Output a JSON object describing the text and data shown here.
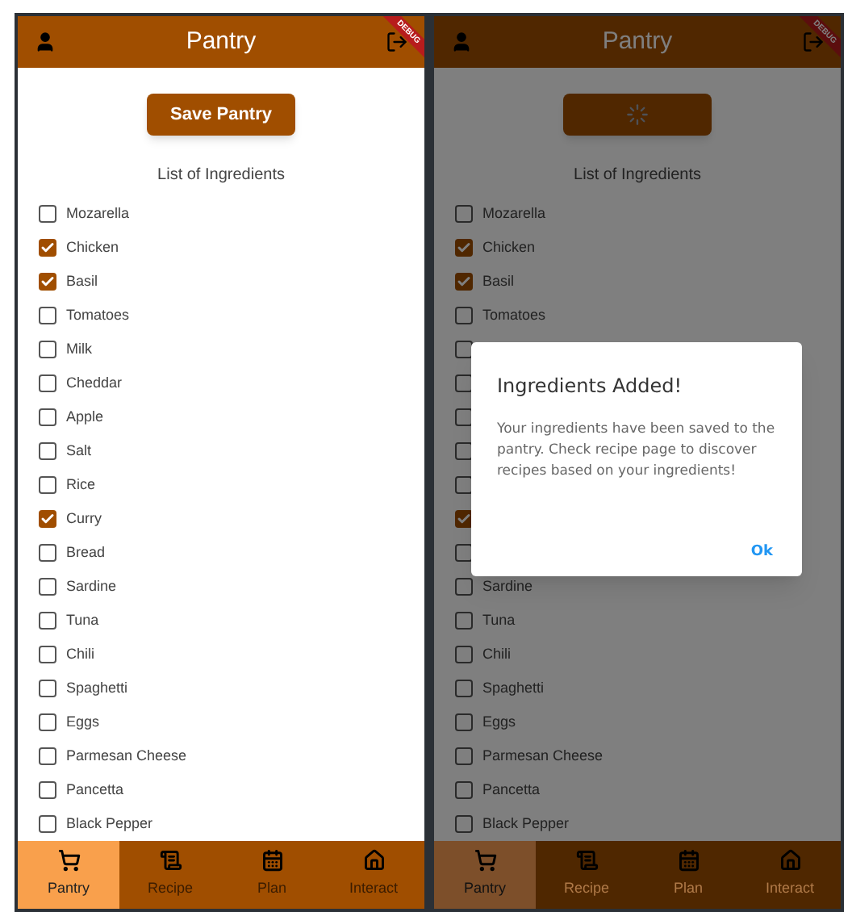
{
  "screens": [
    {
      "title": "Pantry",
      "debug_banner": "DEBUG",
      "save_button": {
        "kind": "label",
        "label": "Save Pantry"
      },
      "list_heading": "List of Ingredients",
      "ingredients": [
        {
          "label": "Mozarella",
          "checked": false
        },
        {
          "label": "Chicken",
          "checked": true
        },
        {
          "label": "Basil",
          "checked": true
        },
        {
          "label": "Tomatoes",
          "checked": false
        },
        {
          "label": "Milk",
          "checked": false
        },
        {
          "label": "Cheddar",
          "checked": false
        },
        {
          "label": "Apple",
          "checked": false
        },
        {
          "label": "Salt",
          "checked": false
        },
        {
          "label": "Rice",
          "checked": false
        },
        {
          "label": "Curry",
          "checked": true
        },
        {
          "label": "Bread",
          "checked": false
        },
        {
          "label": "Sardine",
          "checked": false
        },
        {
          "label": "Tuna",
          "checked": false
        },
        {
          "label": "Chili",
          "checked": false
        },
        {
          "label": "Spaghetti",
          "checked": false
        },
        {
          "label": "Eggs",
          "checked": false
        },
        {
          "label": "Parmesan Cheese",
          "checked": false
        },
        {
          "label": "Pancetta",
          "checked": false
        },
        {
          "label": "Black Pepper",
          "checked": false
        }
      ],
      "nav": [
        {
          "label": "Pantry",
          "kind": "cart",
          "selected": true
        },
        {
          "label": "Recipe",
          "kind": "recipe",
          "selected": false
        },
        {
          "label": "Plan",
          "kind": "calendar",
          "selected": false
        },
        {
          "label": "Interact",
          "kind": "home",
          "selected": false
        }
      ]
    },
    {
      "title": "Pantry",
      "debug_banner": "DEBUG",
      "save_button": {
        "kind": "loading"
      },
      "list_heading": "List of Ingredients",
      "ingredients": [
        {
          "label": "Mozarella",
          "checked": false
        },
        {
          "label": "Chicken",
          "checked": true
        },
        {
          "label": "Basil",
          "checked": true
        },
        {
          "label": "Tomatoes",
          "checked": false
        },
        {
          "checked": false
        },
        {
          "checked": false
        },
        {
          "checked": false
        },
        {
          "checked": false
        },
        {
          "checked": false
        },
        {
          "checked": true
        },
        {
          "checked": false
        },
        {
          "label": "Sardine",
          "checked": false
        },
        {
          "label": "Tuna",
          "checked": false
        },
        {
          "label": "Chili",
          "checked": false
        },
        {
          "label": "Spaghetti",
          "checked": false
        },
        {
          "label": "Eggs",
          "checked": false
        },
        {
          "label": "Parmesan Cheese",
          "checked": false
        },
        {
          "label": "Pancetta",
          "checked": false
        },
        {
          "label": "Black Pepper",
          "checked": false
        }
      ],
      "nav": [
        {
          "label": "Pantry",
          "kind": "cart",
          "selected": true
        },
        {
          "label": "Recipe",
          "kind": "recipe",
          "selected": false
        },
        {
          "label": "Plan",
          "kind": "calendar",
          "selected": false
        },
        {
          "label": "Interact",
          "kind": "home",
          "selected": false
        }
      ],
      "dialog": {
        "title": "Ingredients Added!",
        "message": "Your ingredients have been saved to the pantry. Check recipe page to discover recipes based on your ingredients!",
        "button": "Ok"
      }
    }
  ]
}
